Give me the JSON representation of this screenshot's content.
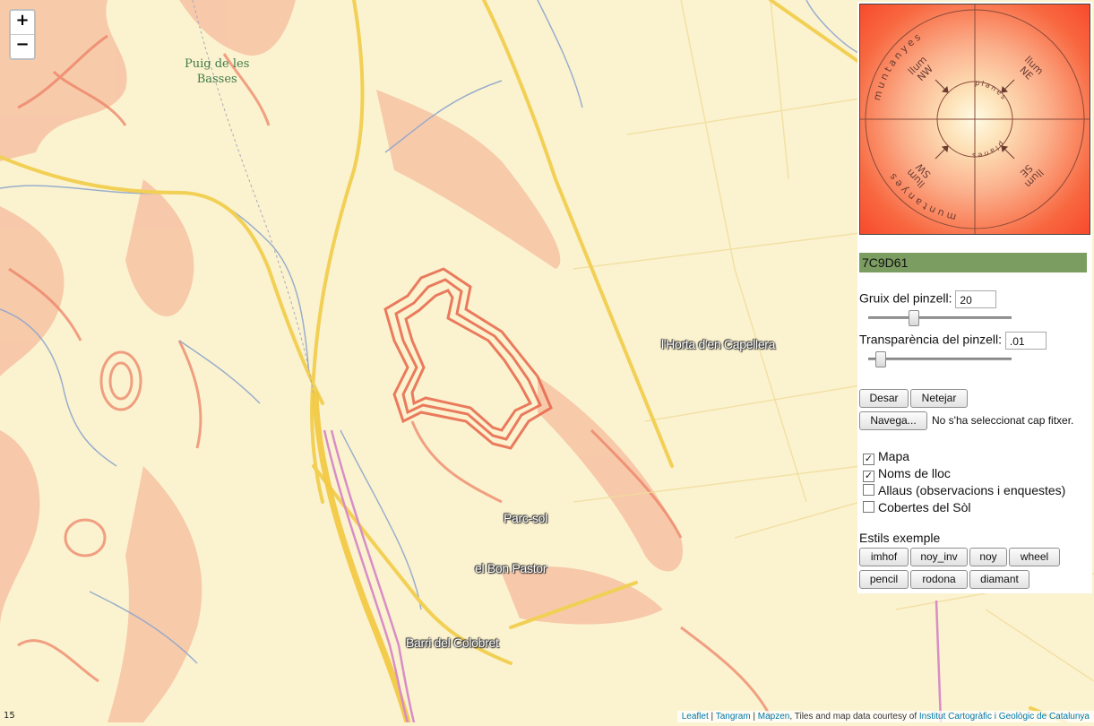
{
  "map": {
    "zoom_level": "15",
    "zoom_in": "+",
    "zoom_out": "−",
    "labels": {
      "puig": [
        "Puig de les",
        "Basses"
      ],
      "horta": "l'Horta d'en Capellera",
      "parc": "Parc-sol",
      "bon_pastor": "el Bon Pastor",
      "colobret": "Barri del Colobret"
    },
    "attribution": {
      "leaflet": "Leaflet",
      "sep1": " | ",
      "tangram": "Tangram",
      "sep2": " | ",
      "mapzen": "Mapzen",
      "text": ", Tiles and map data courtesy of ",
      "icgc": "Institut Cartogràfic i Geològic de Catalunya"
    }
  },
  "wheel": {
    "outer_label": "muntanyes",
    "inner_label": "planes",
    "nw": [
      "llum",
      "NW"
    ],
    "ne": [
      "llum",
      "NE"
    ],
    "sw": [
      "llum",
      "SW"
    ],
    "se": [
      "llum",
      "SE"
    ],
    "colors": {
      "edge": "#f74a2d",
      "center": "#fffbe6"
    }
  },
  "panel": {
    "color_value": "7C9D61",
    "brush_size_label": "Gruix del pinzell:",
    "brush_size_value": "20",
    "brush_size_level": 0.3,
    "brush_opacity_label": "Transparència del pinzell:",
    "brush_opacity_value": ".01",
    "brush_opacity_level": 0.05,
    "save_label": "Desar",
    "clear_label": "Netejar",
    "browse_label": "Navega...",
    "file_status": "No s'ha seleccionat cap fitxer.",
    "layers": [
      {
        "label": "Mapa",
        "checked": true
      },
      {
        "label": "Noms de lloc",
        "checked": true
      },
      {
        "label": "Allaus (observacions i enquestes)",
        "checked": false
      },
      {
        "label": "Cobertes del Sòl",
        "checked": false
      }
    ],
    "styles_title": "Estils exemple",
    "styles": [
      "imhof",
      "noy_inv",
      "noy",
      "wheel",
      "pencil",
      "rodona",
      "diamant"
    ]
  }
}
